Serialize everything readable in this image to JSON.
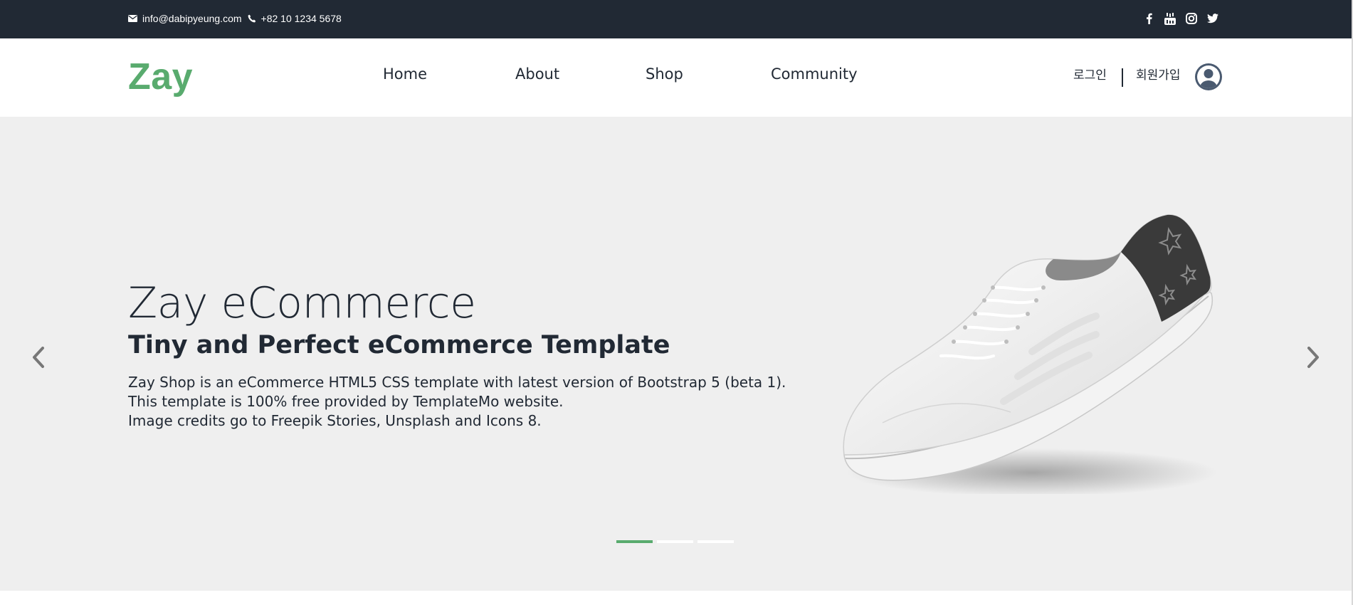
{
  "topbar": {
    "email": "info@dabipyeung.com",
    "phone": "+82 10 1234 5678",
    "social": [
      "facebook-icon",
      "youtube-icon",
      "instagram-icon",
      "twitter-icon"
    ]
  },
  "header": {
    "logo": "Zay",
    "nav": [
      "Home",
      "About",
      "Shop",
      "Community"
    ],
    "login": "로그인",
    "signup": "회원가입"
  },
  "hero": {
    "title": "Zay eCommerce",
    "subtitle": "Tiny and Perfect eCommerce Template",
    "lines": [
      "Zay Shop is an eCommerce HTML5 CSS template with latest version of Bootstrap 5 (beta 1).",
      "This template is 100% free provided by TemplateMo website.",
      "Image credits go to Freepik Stories, Unsplash and Icons 8."
    ],
    "slide_count": 3,
    "active_slide": 1
  },
  "colors": {
    "accent": "#59ab6e",
    "topbar": "#212934",
    "hero_bg": "#efefef",
    "text": "#212934"
  }
}
